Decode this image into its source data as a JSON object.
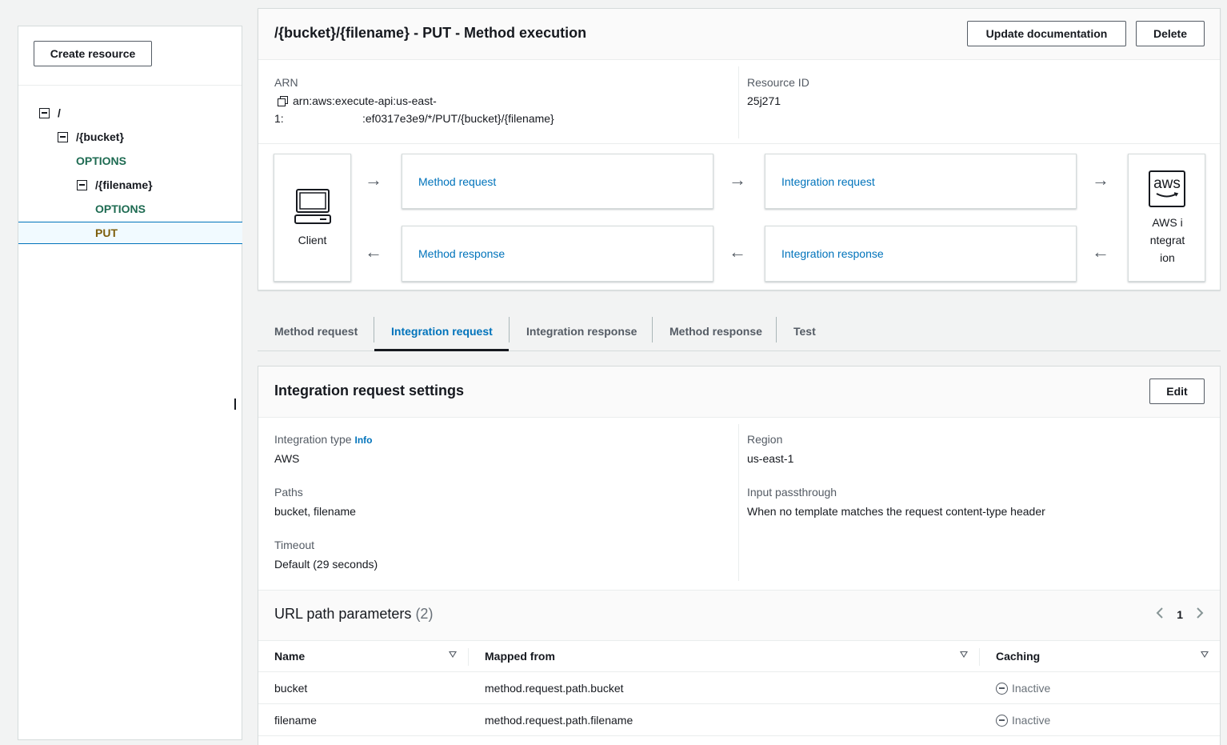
{
  "left_panel": {
    "create_resource_label": "Create resource",
    "tree": {
      "root": "/",
      "bucket": "/{bucket}",
      "bucket_options": "OPTIONS",
      "filename": "/{filename}",
      "filename_options": "OPTIONS",
      "filename_put": "PUT"
    }
  },
  "header": {
    "title": "/{bucket}/{filename} - PUT - Method execution",
    "update_doc_label": "Update documentation",
    "delete_label": "Delete"
  },
  "details": {
    "arn_label": "ARN",
    "arn_line1": "arn:aws:execute-api:us-east-",
    "arn_line2_prefix": "1:",
    "arn_line2_suffix": ":ef0317e3e9/*/PUT/{bucket}/{filename}",
    "resource_id_label": "Resource ID",
    "resource_id_value": "25j271"
  },
  "flow": {
    "client_label": "Client",
    "method_request": "Method request",
    "integration_request": "Integration request",
    "method_response": "Method response",
    "integration_response": "Integration response",
    "aws_logo_text": "aws",
    "aws_integration_label": "AWS integration"
  },
  "tabs": [
    {
      "label": "Method request"
    },
    {
      "label": "Integration request"
    },
    {
      "label": "Integration response"
    },
    {
      "label": "Method response"
    },
    {
      "label": "Test"
    }
  ],
  "settings": {
    "title": "Integration request settings",
    "edit_label": "Edit",
    "integration_type_label": "Integration type",
    "info_label": "Info",
    "integration_type_value": "AWS",
    "paths_label": "Paths",
    "paths_value": "bucket, filename",
    "timeout_label": "Timeout",
    "timeout_value": "Default (29 seconds)",
    "region_label": "Region",
    "region_value": "us-east-1",
    "passthrough_label": "Input passthrough",
    "passthrough_value": "When no template matches the request content-type header"
  },
  "url_params": {
    "title": "URL path parameters",
    "count": "(2)",
    "page": "1",
    "columns": [
      "Name",
      "Mapped from",
      "Caching"
    ],
    "rows": [
      {
        "name": "bucket",
        "mapped_from": "method.request.path.bucket",
        "caching": "Inactive"
      },
      {
        "name": "filename",
        "mapped_from": "method.request.path.filename",
        "caching": "Inactive"
      }
    ]
  }
}
